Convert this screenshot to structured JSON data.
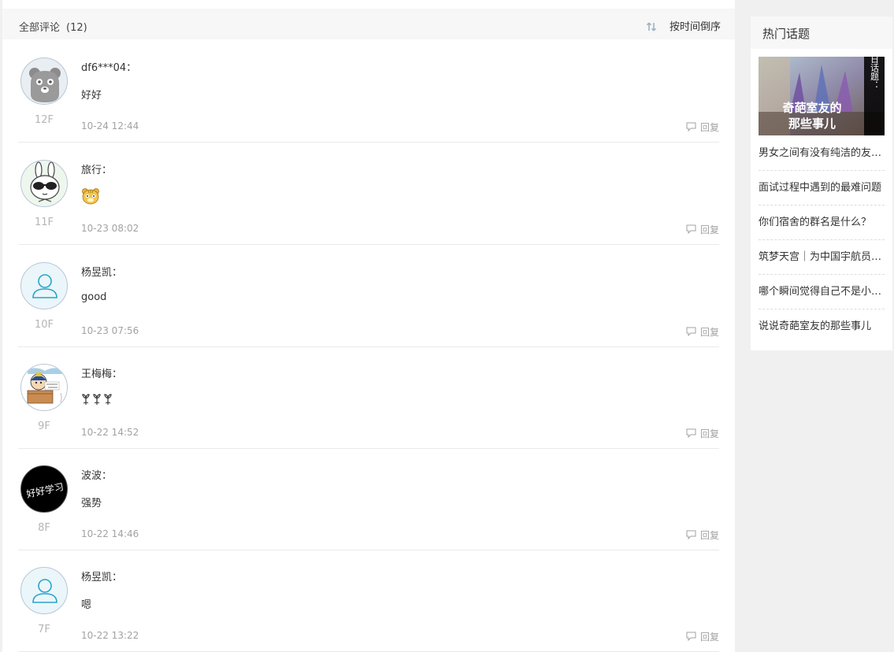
{
  "header": {
    "title": "全部评论",
    "count": "(12)",
    "sort_label": "按时间倒序",
    "sort_icon": "sort-arrows-icon"
  },
  "comments": [
    {
      "username": "df6***04：",
      "text": "好好",
      "floor": "12F",
      "time": "10-24 12:44",
      "reply": "回复",
      "avatar": "bear-avatar"
    },
    {
      "username": "旅行：",
      "text": "",
      "emoji": "tiger-emoji",
      "floor": "11F",
      "time": "10-23 08:02",
      "reply": "回复",
      "avatar": "rabbit-sunglasses-avatar"
    },
    {
      "username": "杨昱凯：",
      "text": "good",
      "floor": "10F",
      "time": "10-23 07:56",
      "reply": "回复",
      "avatar": "default-user-avatar"
    },
    {
      "username": "王梅梅：",
      "text": "",
      "emoji": "sprout-emoji-x3",
      "floor": "9F",
      "time": "10-22 14:52",
      "reply": "回复",
      "avatar": "cartoon-box-avatar"
    },
    {
      "username": "波波：",
      "text": "强势",
      "floor": "8F",
      "time": "10-22 14:46",
      "reply": "回复",
      "avatar": "haohaoxuexi-avatar",
      "avatar_text": "好好学习"
    },
    {
      "username": "杨昱凯：",
      "text": "嗯",
      "floor": "7F",
      "time": "10-22 13:22",
      "reply": "回复",
      "avatar": "default-user-avatar"
    }
  ],
  "sidebar": {
    "title": "热门话题",
    "image_caption_vertical": "今日话题：",
    "image_caption_main_1": "奇葩室友的",
    "image_caption_main_2": "那些事儿",
    "topics": [
      "男女之间有没有纯洁的友谊？",
      "面试过程中遇到的最难问题",
      "你们宿舍的群名是什么？",
      "筑梦天宫｜为中国宇航员加油",
      "哪个瞬间觉得自己不是小孩了",
      "说说奇葩室友的那些事儿"
    ]
  },
  "colors": {
    "accent_blue": "#2aa4c9",
    "muted": "#a2a2a2",
    "header_bg": "#f7f7f7",
    "page_bg": "#f0f0f0"
  }
}
